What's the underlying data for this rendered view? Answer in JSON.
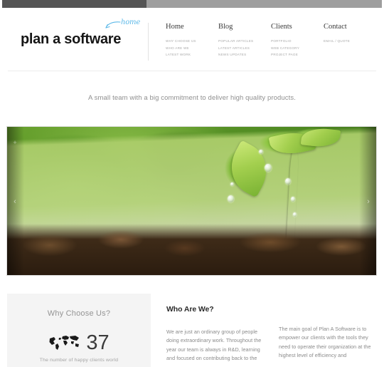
{
  "chrome": {
    "dark_bar": "#555555",
    "light_bar": "#9e9e9e"
  },
  "header": {
    "logo": "plan a software",
    "scribble_note": "home",
    "scribble_color": "#5bb8e8",
    "nav": [
      {
        "title": "Home",
        "items": [
          "WHY CHOOSE US",
          "WHO ARE WE",
          "LATEST WORK"
        ]
      },
      {
        "title": "Blog",
        "items": [
          "POPULAR ARTICLES",
          "LATEST ARTICLES",
          "NEWS UPDATES"
        ]
      },
      {
        "title": "Clients",
        "items": [
          "PORTFOLIO",
          "WEB CATEGORY",
          "PROJECT PAGE"
        ]
      },
      {
        "title": "Contact",
        "items": [
          "EMAIL / QUOTE"
        ]
      }
    ]
  },
  "tagline": "A small team with a big commitment to deliver high quality products.",
  "hero": {
    "alt": "green seedling sprouting from soil with water droplets",
    "prev_arrow": "‹",
    "next_arrow": "›",
    "zoom_icon": "+"
  },
  "why_choose": {
    "title": "Why Choose Us?",
    "counter": "37",
    "caption": "The number of happy clients world",
    "map_icon": "world-map"
  },
  "who_are_we": {
    "title": "Who Are We?",
    "body": "We are just an ordinary group of people doing extraordinary work. Throughout the year our team is always in R&D, learning and focused on contributing back to the"
  },
  "main_goal": {
    "body": "The main goal of Plan A Software is to empower our clients with the tools they need to operate their organization at the highest level of efficiency and"
  }
}
